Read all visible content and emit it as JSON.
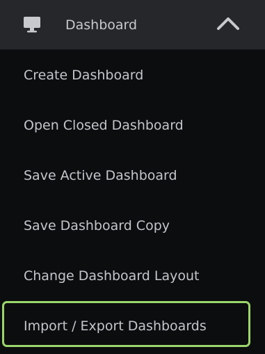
{
  "header": {
    "title": "Dashboard",
    "icon": "monitor-icon",
    "toggle_icon": "chevron-up-icon"
  },
  "items": [
    {
      "label": "Create Dashboard"
    },
    {
      "label": "Open Closed Dashboard"
    },
    {
      "label": "Save Active Dashboard"
    },
    {
      "label": "Save Dashboard Copy"
    },
    {
      "label": "Change Dashboard Layout"
    },
    {
      "label": "Import / Export Dashboards"
    }
  ],
  "colors": {
    "background": "#0c0d0f",
    "header_background": "#25272b",
    "text": "#c4c6ca",
    "highlight_border": "#9ad66b"
  }
}
